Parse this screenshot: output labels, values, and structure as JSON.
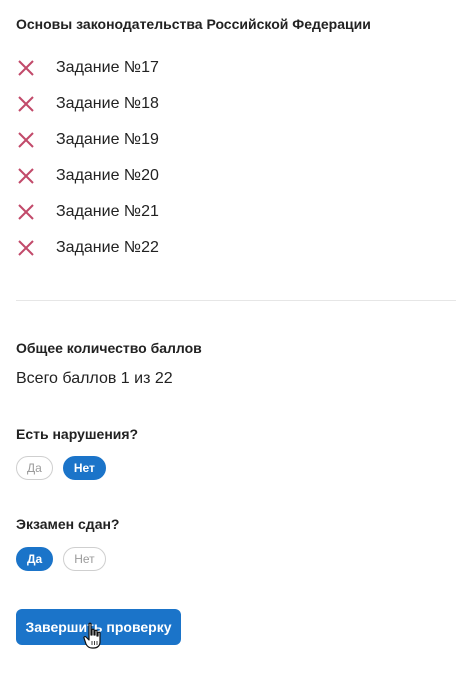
{
  "section": {
    "title": "Основы законодательства Российской Федерации"
  },
  "tasks": [
    {
      "label": "Задание №17",
      "status_icon": "x-icon"
    },
    {
      "label": "Задание №18",
      "status_icon": "x-icon"
    },
    {
      "label": "Задание №19",
      "status_icon": "x-icon"
    },
    {
      "label": "Задание №20",
      "status_icon": "x-icon"
    },
    {
      "label": "Задание №21",
      "status_icon": "x-icon"
    },
    {
      "label": "Задание №22",
      "status_icon": "x-icon"
    }
  ],
  "total": {
    "title": "Общее количество баллов",
    "text": "Всего баллов 1 из 22"
  },
  "violations": {
    "question": "Есть нарушения?",
    "yes_label": "Да",
    "no_label": "Нет",
    "selected": "no"
  },
  "exam_passed": {
    "question": "Экзамен сдан?",
    "yes_label": "Да",
    "no_label": "Нет",
    "selected": "yes"
  },
  "actions": {
    "finish_label": "Завершить проверку"
  },
  "colors": {
    "accent": "#1b74c9",
    "error_icon": "#c24a6a",
    "divider": "#e6e6e6"
  }
}
